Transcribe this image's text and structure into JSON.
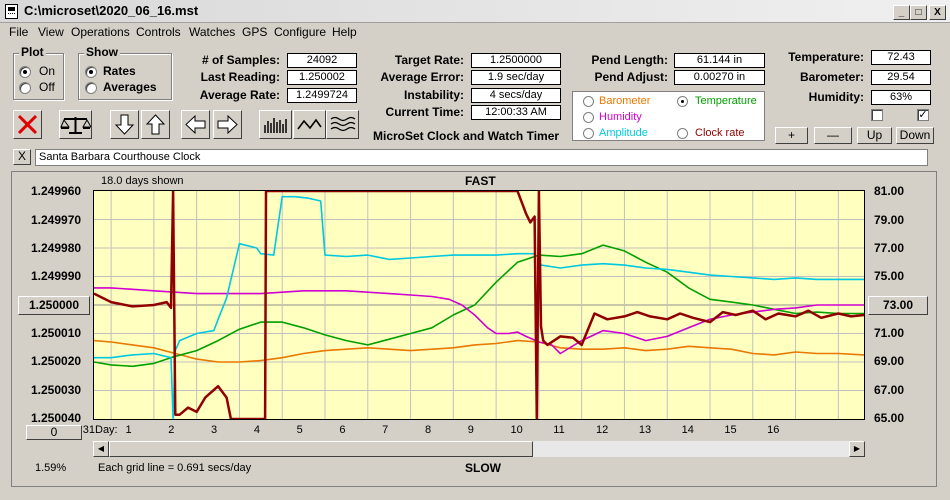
{
  "window": {
    "title": "C:\\microset\\2020_06_16.mst"
  },
  "menu": [
    "File",
    "View",
    "Operations",
    "Controls",
    "Watches",
    "GPS",
    "Configure",
    "Help"
  ],
  "plot_group": {
    "title": "Plot",
    "options": [
      "On",
      "Off"
    ],
    "selected": "On"
  },
  "show_group": {
    "title": "Show",
    "options": [
      "Rates",
      "Averages"
    ],
    "selected": "Rates"
  },
  "stats": {
    "samples_label": "# of Samples:",
    "samples": "24092",
    "last_reading_label": "Last Reading:",
    "last_reading": "1.250002",
    "average_rate_label": "Average Rate:",
    "average_rate": "1.2499724",
    "target_rate_label": "Target Rate:",
    "target_rate": "1.2500000",
    "average_error_label": "Average Error:",
    "average_error": "1.9 sec/day",
    "instability_label": "Instability:",
    "instability": "4 secs/day",
    "current_time_label": "Current Time:",
    "current_time": "12:00:33 AM",
    "pend_length_label": "Pend Length:",
    "pend_length": "61.144 in",
    "pend_adjust_label": "Pend Adjust:",
    "pend_adjust": "0.00270 in",
    "temperature_label": "Temperature:",
    "temperature": "72.43",
    "barometer_label": "Barometer:",
    "barometer": "29.54",
    "humidity_label": "Humidity:",
    "humidity": "63%"
  },
  "app_caption": "MicroSet Clock and Watch Timer",
  "overlay_legend": [
    {
      "label": "Barometer",
      "color": "#e87800",
      "checked": false
    },
    {
      "label": "Temperature",
      "color": "#00a000",
      "checked": true
    },
    {
      "label": "Humidity",
      "color": "#d000d0",
      "checked": false
    },
    {
      "label": "Amplitude",
      "color": "#00c8e0",
      "checked": false
    },
    {
      "label": "Clock rate",
      "color": "#900000",
      "checked": false
    }
  ],
  "adjust_buttons": {
    "plus": "+",
    "minus": "—",
    "up": "Up",
    "down": "Down"
  },
  "checkboxes": [
    {
      "checked": false
    },
    {
      "checked": true
    }
  ],
  "clock_name": "Santa Barbara Courthouse Clock",
  "close_label": "X",
  "icons": [
    "close-x-icon",
    "balance-scale-icon",
    "arrow-down-icon",
    "arrow-up-icon",
    "arrow-left-icon",
    "arrow-right-icon",
    "bar-chart-icon",
    "wave-icon",
    "multi-wave-icon"
  ],
  "chart_panel": {
    "days_shown": "18.0 days shown",
    "top_label": "FAST",
    "bottom_label": "SLOW",
    "center_value_button": "1.250000",
    "right_value_button": "73.00",
    "zero_button": "0",
    "day_label": "Day:",
    "grid_note": "Each grid line = 0.691 secs/day",
    "percent": "1.59%"
  },
  "chart_data": {
    "type": "line",
    "x_axis": {
      "label": "Day:",
      "ticks": [
        "31",
        "1",
        "2",
        "3",
        "4",
        "5",
        "6",
        "7",
        "8",
        "9",
        "10",
        "11",
        "12",
        "13",
        "14",
        "15",
        "16"
      ]
    },
    "y_left": {
      "ticks": [
        "1.249960",
        "1.249970",
        "1.249980",
        "1.249990",
        "1.250000",
        "1.250010",
        "1.250020",
        "1.250030",
        "1.250040"
      ],
      "range": [
        1.24996,
        1.25004
      ],
      "inverted": true
    },
    "y_right": {
      "ticks": [
        "81.00",
        "79.00",
        "77.00",
        "75.00",
        "73.00",
        "71.00",
        "69.00",
        "67.00",
        "65.00"
      ],
      "range": [
        65,
        81
      ]
    },
    "x_range": [
      30.6,
      48.6
    ],
    "grid": true,
    "series": [
      {
        "name": "Barometer",
        "color": "#e87800",
        "axis": "right",
        "x": [
          30.6,
          31.0,
          31.5,
          32.0,
          32.5,
          33.0,
          33.5,
          34.0,
          34.5,
          35.0,
          35.5,
          36.0,
          36.5,
          37.0,
          37.5,
          38.0,
          38.5,
          39.0,
          39.5,
          40.0,
          40.5,
          41.0,
          41.5,
          42.0,
          42.5,
          43.0,
          43.5,
          44.0,
          44.5,
          45.0,
          45.5,
          46.0,
          46.5,
          47.0,
          47.5,
          48.0,
          48.6
        ],
        "y": [
          70.5,
          70.4,
          70.2,
          70.0,
          69.6,
          69.2,
          69.0,
          69.0,
          69.1,
          69.3,
          69.6,
          69.8,
          69.9,
          70.0,
          69.9,
          69.8,
          69.9,
          70.0,
          70.2,
          70.3,
          70.5,
          70.4,
          70.0,
          69.9,
          69.9,
          70.0,
          69.8,
          69.9,
          70.1,
          70.0,
          69.9,
          69.6,
          69.5,
          69.7,
          69.6,
          69.6,
          69.5
        ]
      },
      {
        "name": "Temperature",
        "color": "#00a000",
        "axis": "right",
        "x": [
          30.6,
          31.0,
          31.5,
          32.0,
          32.5,
          33.0,
          33.5,
          34.0,
          34.5,
          35.0,
          35.5,
          36.0,
          36.5,
          37.0,
          37.5,
          38.0,
          38.5,
          39.0,
          39.5,
          40.0,
          40.5,
          41.0,
          41.5,
          42.0,
          42.5,
          43.0,
          43.5,
          44.0,
          44.5,
          45.0,
          45.5,
          46.0,
          46.5,
          47.0,
          47.5,
          48.0,
          48.6
        ],
        "y": [
          69.0,
          68.8,
          68.7,
          68.9,
          69.4,
          69.8,
          70.5,
          71.3,
          71.8,
          71.8,
          71.4,
          70.9,
          70.5,
          70.2,
          70.6,
          71.0,
          71.4,
          72.3,
          73.0,
          74.6,
          76.0,
          76.5,
          76.4,
          76.6,
          77.2,
          76.8,
          76.0,
          75.3,
          74.2,
          73.4,
          73.2,
          73.0,
          72.7,
          72.4,
          72.5,
          72.4,
          72.4
        ]
      },
      {
        "name": "Humidity",
        "color": "#d000d0",
        "axis": "right",
        "x": [
          30.6,
          31.0,
          31.5,
          32.0,
          32.5,
          33.0,
          33.5,
          34.0,
          34.5,
          35.0,
          35.5,
          36.0,
          36.5,
          37.0,
          37.5,
          38.0,
          38.5,
          38.9,
          39.2,
          39.5,
          39.8,
          40.0,
          40.3,
          40.5,
          40.7,
          41.0,
          41.3,
          41.5,
          42.0,
          42.5,
          43.0,
          43.5,
          44.0,
          44.5,
          45.0,
          45.5,
          46.0,
          46.5,
          47.0,
          47.5,
          48.0,
          48.6
        ],
        "y": [
          74.2,
          74.2,
          74.1,
          74.0,
          73.9,
          73.8,
          73.8,
          73.8,
          73.8,
          73.9,
          74.0,
          74.0,
          74.0,
          73.9,
          73.8,
          73.7,
          73.6,
          73.4,
          73.0,
          72.3,
          71.4,
          71.0,
          71.0,
          71.1,
          70.8,
          70.4,
          70.2,
          69.6,
          70.5,
          71.2,
          71.0,
          70.5,
          70.8,
          71.4,
          72.0,
          72.3,
          72.5,
          72.7,
          72.8,
          73.0,
          73.0,
          73.0
        ]
      },
      {
        "name": "Amplitude",
        "color": "#00c8e0",
        "axis": "right",
        "x": [
          30.6,
          31.0,
          31.5,
          32.0,
          32.4,
          32.45,
          32.5,
          32.6,
          33.0,
          33.4,
          33.5,
          33.7,
          34.0,
          34.4,
          34.5,
          34.8,
          35.0,
          35.3,
          35.6,
          35.9,
          36.0,
          36.5,
          37.0,
          37.5,
          38.0,
          38.5,
          39.0,
          39.5,
          40.0,
          40.5,
          40.9,
          40.95,
          41.0,
          41.05,
          41.5,
          42.0,
          42.5,
          43.0,
          43.5,
          44.0,
          44.5,
          45.0,
          45.5,
          46.0,
          46.5,
          47.0,
          47.5,
          48.0,
          48.6
        ],
        "y": [
          69.3,
          69.3,
          69.5,
          69.6,
          69.3,
          65.0,
          69.8,
          70.5,
          71.0,
          71.2,
          72.0,
          73.5,
          77.3,
          77.0,
          76.6,
          76.5,
          80.6,
          80.6,
          80.5,
          80.3,
          76.5,
          76.4,
          76.5,
          76.2,
          76.3,
          76.4,
          76.5,
          76.5,
          76.5,
          76.6,
          76.6,
          65.0,
          76.3,
          75.8,
          75.6,
          75.8,
          75.9,
          75.8,
          75.6,
          75.5,
          75.3,
          75.1,
          75.0,
          74.9,
          74.8,
          74.9,
          74.8,
          74.8,
          74.8
        ]
      },
      {
        "name": "Clock rate",
        "color": "#900000",
        "axis": "right",
        "x": [
          30.6,
          31.0,
          31.5,
          32.0,
          32.3,
          32.4,
          32.45,
          32.5,
          32.6,
          32.8,
          33.0,
          33.2,
          33.5,
          33.7,
          33.8,
          33.9,
          34.0,
          34.3,
          34.6,
          34.62,
          34.7,
          35.0,
          36.0,
          37.0,
          38.0,
          39.0,
          39.5,
          40.0,
          40.3,
          40.5,
          40.7,
          40.8,
          40.9,
          40.95,
          41.0,
          41.05,
          41.1,
          41.2,
          41.5,
          41.8,
          42.0,
          42.3,
          42.6,
          43.0,
          43.3,
          43.6,
          44.0,
          44.3,
          44.6,
          45.0,
          45.3,
          45.6,
          46.0,
          46.3,
          46.6,
          47.0,
          47.3,
          47.6,
          48.0,
          48.3,
          48.6
        ],
        "y": [
          73.8,
          73.2,
          72.9,
          73.0,
          73.2,
          72.8,
          81.0,
          65.3,
          65.3,
          65.8,
          65.5,
          66.5,
          67.3,
          66.5,
          65.0,
          65.0,
          65.0,
          65.0,
          65.0,
          81.0,
          81.0,
          81.0,
          81.0,
          81.0,
          81.0,
          81.0,
          81.0,
          81.0,
          81.0,
          81.0,
          79.4,
          78.8,
          79.2,
          65.0,
          81.0,
          71.5,
          70.5,
          70.2,
          70.8,
          70.7,
          70.2,
          72.4,
          72.0,
          72.2,
          72.5,
          72.2,
          72.0,
          72.4,
          72.1,
          71.8,
          72.5,
          72.3,
          72.6,
          72.0,
          72.4,
          72.2,
          72.6,
          72.1,
          72.4,
          72.2,
          72.3
        ]
      }
    ]
  },
  "colors": {
    "plot_bg": "#ffffc0",
    "grid": "#c0c0c0",
    "window_bg": "#d4d0c8"
  }
}
